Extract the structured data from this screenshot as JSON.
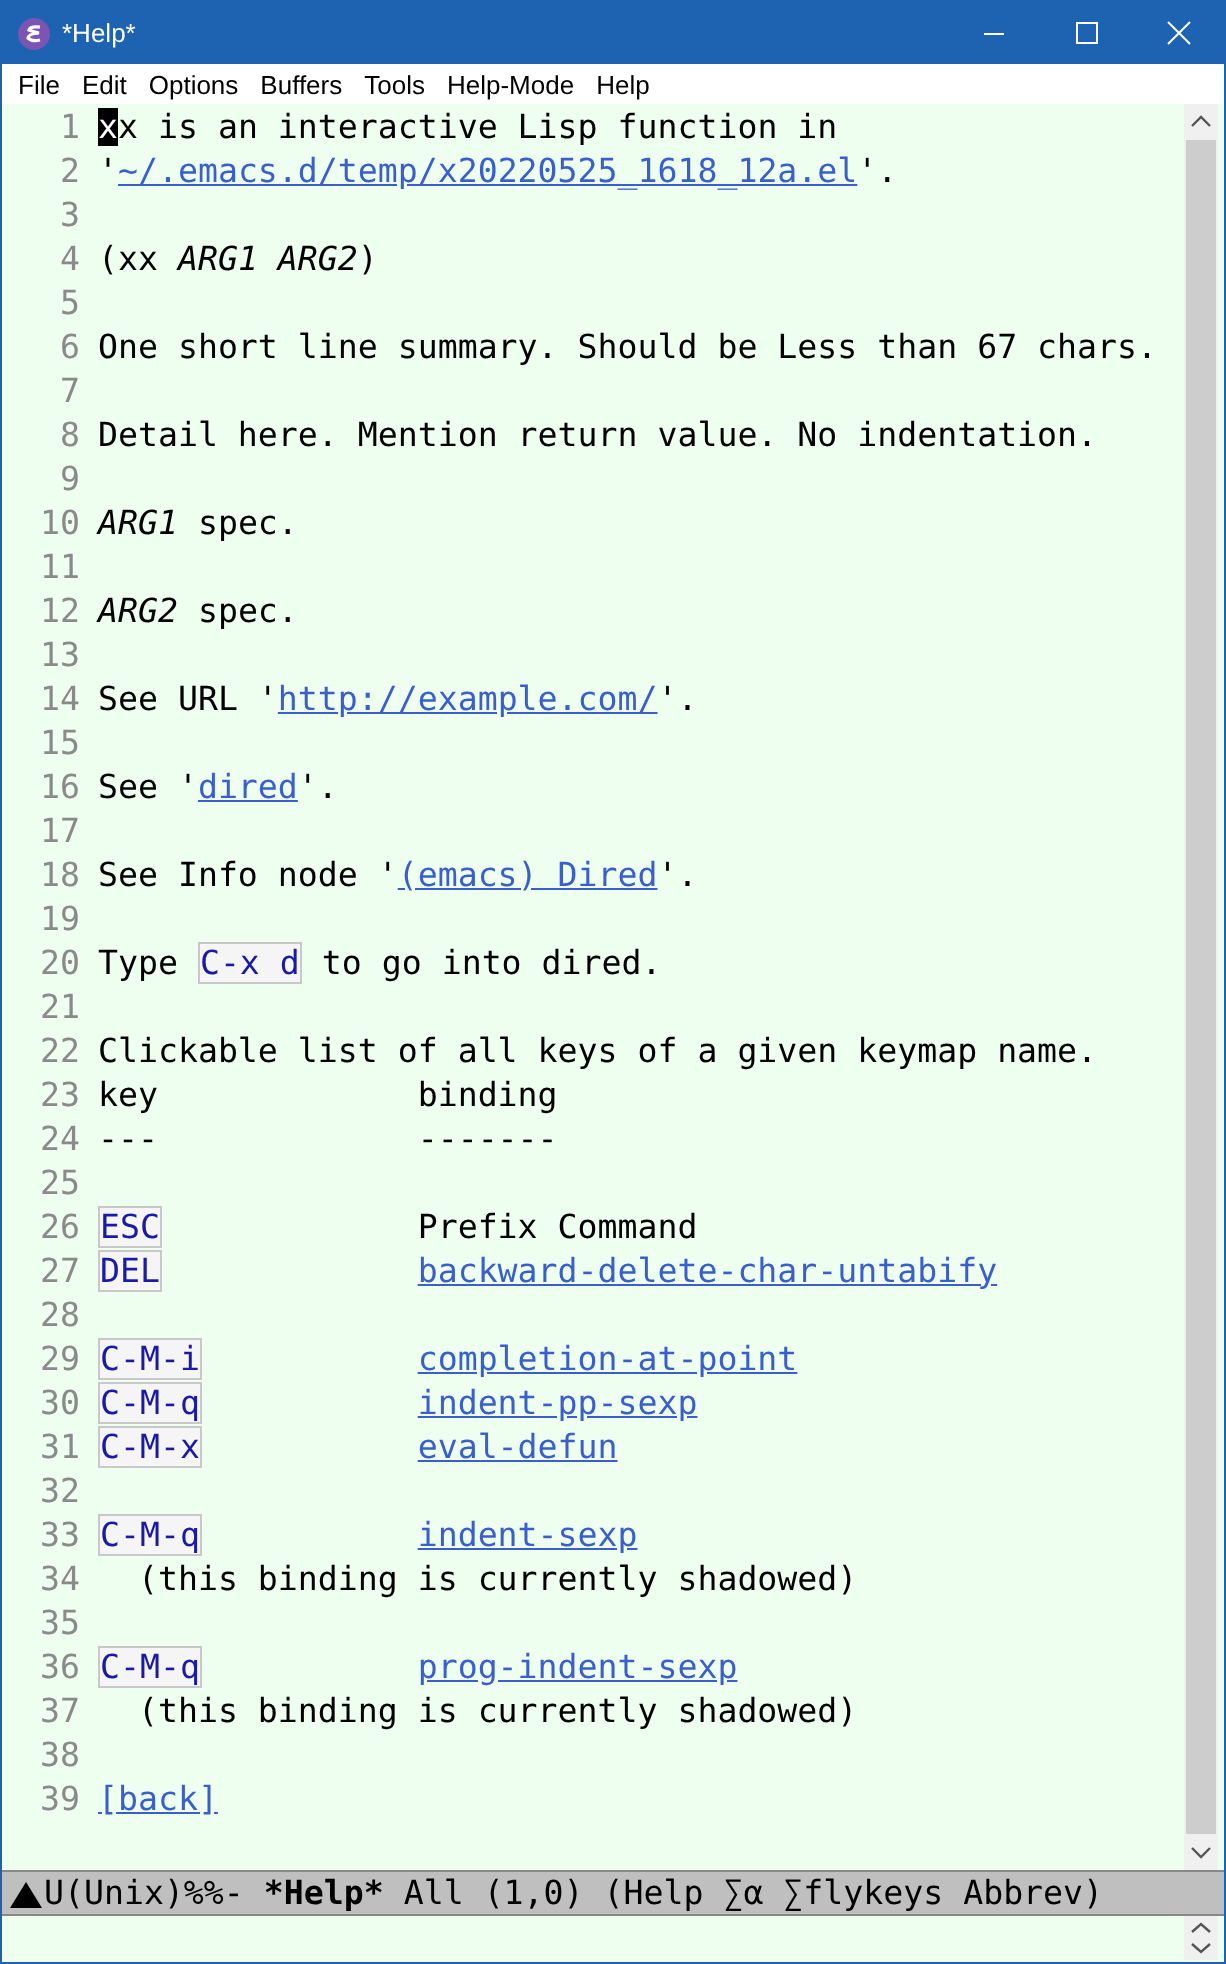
{
  "window": {
    "title": "*Help*"
  },
  "menu": [
    "File",
    "Edit",
    "Options",
    "Buffers",
    "Tools",
    "Help-Mode",
    "Help"
  ],
  "lines": [
    {
      "num": "1",
      "segments": [
        {
          "kind": "cursor",
          "text": "x"
        },
        {
          "kind": "text",
          "text": "x is an interactive Lisp function in"
        }
      ]
    },
    {
      "num": "2",
      "segments": [
        {
          "kind": "text",
          "text": "'"
        },
        {
          "kind": "link",
          "text": "~/.emacs.d/temp/x20220525_1618_12a.el"
        },
        {
          "kind": "text",
          "text": "'."
        }
      ]
    },
    {
      "num": "3"
    },
    {
      "num": "4",
      "segments": [
        {
          "kind": "text",
          "text": "(xx "
        },
        {
          "kind": "italic",
          "text": "ARG1 ARG2"
        },
        {
          "kind": "text",
          "text": ")"
        }
      ]
    },
    {
      "num": "5"
    },
    {
      "num": "6",
      "segments": [
        {
          "kind": "text",
          "text": "One short line summary. Should be Less than 67 chars."
        }
      ]
    },
    {
      "num": "7"
    },
    {
      "num": "8",
      "segments": [
        {
          "kind": "text",
          "text": "Detail here. Mention return value. No indentation."
        }
      ]
    },
    {
      "num": "9"
    },
    {
      "num": "10",
      "segments": [
        {
          "kind": "italic",
          "text": "ARG1"
        },
        {
          "kind": "text",
          "text": " spec."
        }
      ]
    },
    {
      "num": "11"
    },
    {
      "num": "12",
      "segments": [
        {
          "kind": "italic",
          "text": "ARG2"
        },
        {
          "kind": "text",
          "text": " spec."
        }
      ]
    },
    {
      "num": "13"
    },
    {
      "num": "14",
      "segments": [
        {
          "kind": "text",
          "text": "See URL '"
        },
        {
          "kind": "link",
          "text": "http://example.com/"
        },
        {
          "kind": "text",
          "text": "'."
        }
      ]
    },
    {
      "num": "15"
    },
    {
      "num": "16",
      "segments": [
        {
          "kind": "text",
          "text": "See '"
        },
        {
          "kind": "link",
          "text": "dired"
        },
        {
          "kind": "text",
          "text": "'."
        }
      ]
    },
    {
      "num": "17"
    },
    {
      "num": "18",
      "segments": [
        {
          "kind": "text",
          "text": "See Info node '"
        },
        {
          "kind": "link",
          "text": "(emacs) Dired"
        },
        {
          "kind": "text",
          "text": "'."
        }
      ]
    },
    {
      "num": "19"
    },
    {
      "num": "20",
      "segments": [
        {
          "kind": "text",
          "text": "Type "
        },
        {
          "kind": "key",
          "text": "C-x d"
        },
        {
          "kind": "text",
          "text": " to go into dired."
        }
      ]
    },
    {
      "num": "21"
    },
    {
      "num": "22",
      "segments": [
        {
          "kind": "text",
          "text": "Clickable list of all keys of a given keymap name."
        }
      ]
    },
    {
      "num": "23",
      "segments": [
        {
          "kind": "text",
          "text": "key             binding"
        }
      ]
    },
    {
      "num": "24",
      "segments": [
        {
          "kind": "text",
          "text": "---             -------"
        }
      ]
    },
    {
      "num": "25"
    },
    {
      "num": "26",
      "segments": [
        {
          "kind": "key",
          "text": "ESC"
        },
        {
          "kind": "gap"
        },
        {
          "kind": "text",
          "text": "Prefix Command"
        }
      ]
    },
    {
      "num": "27",
      "segments": [
        {
          "kind": "key",
          "text": "DEL"
        },
        {
          "kind": "gap"
        },
        {
          "kind": "link",
          "text": "backward-delete-char-untabify"
        }
      ]
    },
    {
      "num": "28"
    },
    {
      "num": "29",
      "segments": [
        {
          "kind": "key",
          "text": "C-M-i"
        },
        {
          "kind": "gap"
        },
        {
          "kind": "link",
          "text": "completion-at-point"
        }
      ]
    },
    {
      "num": "30",
      "segments": [
        {
          "kind": "key",
          "text": "C-M-q"
        },
        {
          "kind": "gap"
        },
        {
          "kind": "link",
          "text": "indent-pp-sexp"
        }
      ]
    },
    {
      "num": "31",
      "segments": [
        {
          "kind": "key",
          "text": "C-M-x"
        },
        {
          "kind": "gap"
        },
        {
          "kind": "link",
          "text": "eval-defun"
        }
      ]
    },
    {
      "num": "32"
    },
    {
      "num": "33",
      "segments": [
        {
          "kind": "key",
          "text": "C-M-q"
        },
        {
          "kind": "gap"
        },
        {
          "kind": "link",
          "text": "indent-sexp"
        }
      ]
    },
    {
      "num": "34",
      "segments": [
        {
          "kind": "text",
          "text": "  (this binding is currently shadowed)"
        }
      ]
    },
    {
      "num": "35"
    },
    {
      "num": "36",
      "segments": [
        {
          "kind": "key",
          "text": "C-M-q"
        },
        {
          "kind": "gap"
        },
        {
          "kind": "link",
          "text": "prog-indent-sexp"
        }
      ]
    },
    {
      "num": "37",
      "segments": [
        {
          "kind": "text",
          "text": "  (this binding is currently shadowed)"
        }
      ]
    },
    {
      "num": "38"
    },
    {
      "num": "39",
      "segments": [
        {
          "kind": "link",
          "text": "[back]"
        }
      ]
    }
  ],
  "mode_line": {
    "status": "U(Unix)%%-",
    "buffer": "*Help*",
    "info": "All (1,0) (Help ∑α ∑flykeys Abbrev)"
  }
}
